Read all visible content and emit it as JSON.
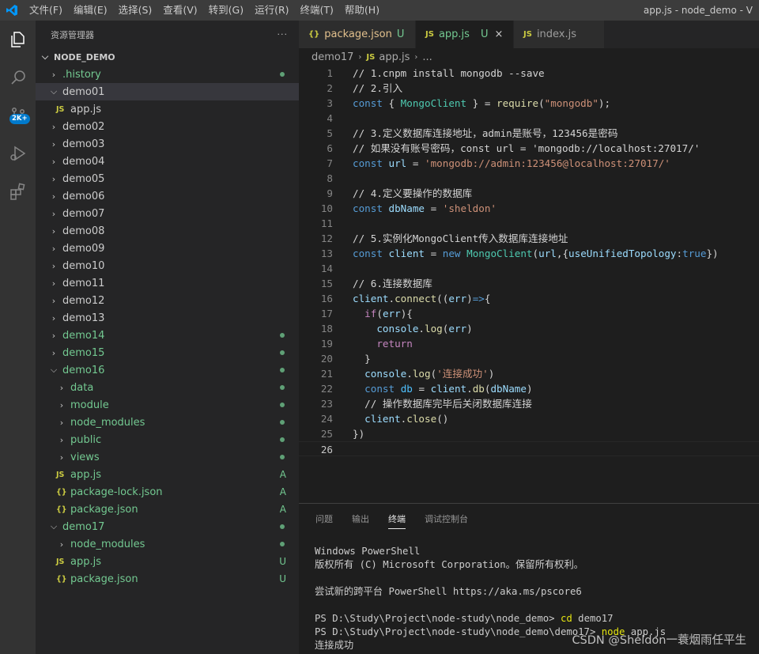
{
  "titlebar": {
    "menu": [
      "文件(F)",
      "编辑(E)",
      "选择(S)",
      "查看(V)",
      "转到(G)",
      "运行(R)",
      "终端(T)",
      "帮助(H)"
    ],
    "window_title": "app.js - node_demo - V"
  },
  "activity": {
    "badge": "2K+"
  },
  "sidebar": {
    "title": "资源管理器",
    "more": "···",
    "root": "NODE_DEMO",
    "items": [
      {
        "label": ".history",
        "status": ""
      },
      {
        "label": "demo01",
        "status": ""
      },
      {
        "label": "app.js",
        "status": ""
      },
      {
        "label": "demo02",
        "status": ""
      },
      {
        "label": "demo03",
        "status": ""
      },
      {
        "label": "demo04",
        "status": ""
      },
      {
        "label": "demo05",
        "status": ""
      },
      {
        "label": "demo06",
        "status": ""
      },
      {
        "label": "demo07",
        "status": ""
      },
      {
        "label": "demo08",
        "status": ""
      },
      {
        "label": "demo09",
        "status": ""
      },
      {
        "label": "demo10",
        "status": ""
      },
      {
        "label": "demo11",
        "status": ""
      },
      {
        "label": "demo12",
        "status": ""
      },
      {
        "label": "demo13",
        "status": ""
      },
      {
        "label": "demo14",
        "status": ""
      },
      {
        "label": "demo15",
        "status": ""
      },
      {
        "label": "demo16",
        "status": ""
      },
      {
        "label": "data",
        "status": ""
      },
      {
        "label": "module",
        "status": ""
      },
      {
        "label": "node_modules",
        "status": ""
      },
      {
        "label": "public",
        "status": ""
      },
      {
        "label": "views",
        "status": ""
      },
      {
        "label": "app.js",
        "status": "A"
      },
      {
        "label": "package-lock.json",
        "status": "A"
      },
      {
        "label": "package.json",
        "status": "A"
      },
      {
        "label": "demo17",
        "status": ""
      },
      {
        "label": "node_modules",
        "status": ""
      },
      {
        "label": "app.js",
        "status": "U"
      },
      {
        "label": "package.json",
        "status": "U"
      }
    ],
    "js_icon": "JS",
    "json_icon": "{}"
  },
  "tabs": [
    {
      "label": "package.json",
      "status": "U",
      "icon": "{}"
    },
    {
      "label": "app.js",
      "status": "U",
      "icon": "JS"
    },
    {
      "label": "index.js",
      "status": "",
      "icon": "JS"
    }
  ],
  "breadcrumb": {
    "folder": "demo17",
    "file": "app.js",
    "tail": "..."
  },
  "code_lines": [
    "1",
    "2",
    "3",
    "4",
    "5",
    "6",
    "7",
    "8",
    "9",
    "10",
    "11",
    "12",
    "13",
    "14",
    "15",
    "16",
    "17",
    "18",
    "19",
    "20",
    "21",
    "22",
    "23",
    "24",
    "25",
    "26"
  ],
  "code": {
    "l1": "// 1.cnpm install mongodb --save",
    "l2": "// 2.引入",
    "l5": "// 3.定义数据库连接地址，admin是账号，123456是密码",
    "l6": "// 如果没有账号密码，const url = 'mongodb://localhost:27017/'",
    "l9": "// 4.定义要操作的数据库",
    "l12": "// 5.实例化MongoClient传入数据库连接地址",
    "l15": "// 6.连接数据库",
    "l23": "// 操作数据库完毕后关闭数据库连接",
    "mongodb_str": "\"mongodb\"",
    "url_str": "'mongodb://admin:123456@localhost:27017/'",
    "db_str": "'sheldon'",
    "success_str": "'连接成功'"
  },
  "panel": {
    "tabs": [
      "问题",
      "输出",
      "终端",
      "调试控制台"
    ],
    "terminal": {
      "l1": "Windows PowerShell",
      "l2": "版权所有 (C) Microsoft Corporation。保留所有权利。",
      "l3": "",
      "l4": "尝试新的跨平台 PowerShell https://aka.ms/pscore6",
      "l5": "",
      "l6_prompt": "PS D:\\Study\\Project\\node-study\\node_demo> ",
      "l6_cmd": "cd",
      "l6_arg": " demo17",
      "l7_prompt": "PS D:\\Study\\Project\\node-study\\node_demo\\demo17> ",
      "l7_cmd": "node",
      "l7_arg": " app.js",
      "l8": "连接成功"
    }
  },
  "watermark": "CSDN @Sheldon一蓑烟雨任平生"
}
